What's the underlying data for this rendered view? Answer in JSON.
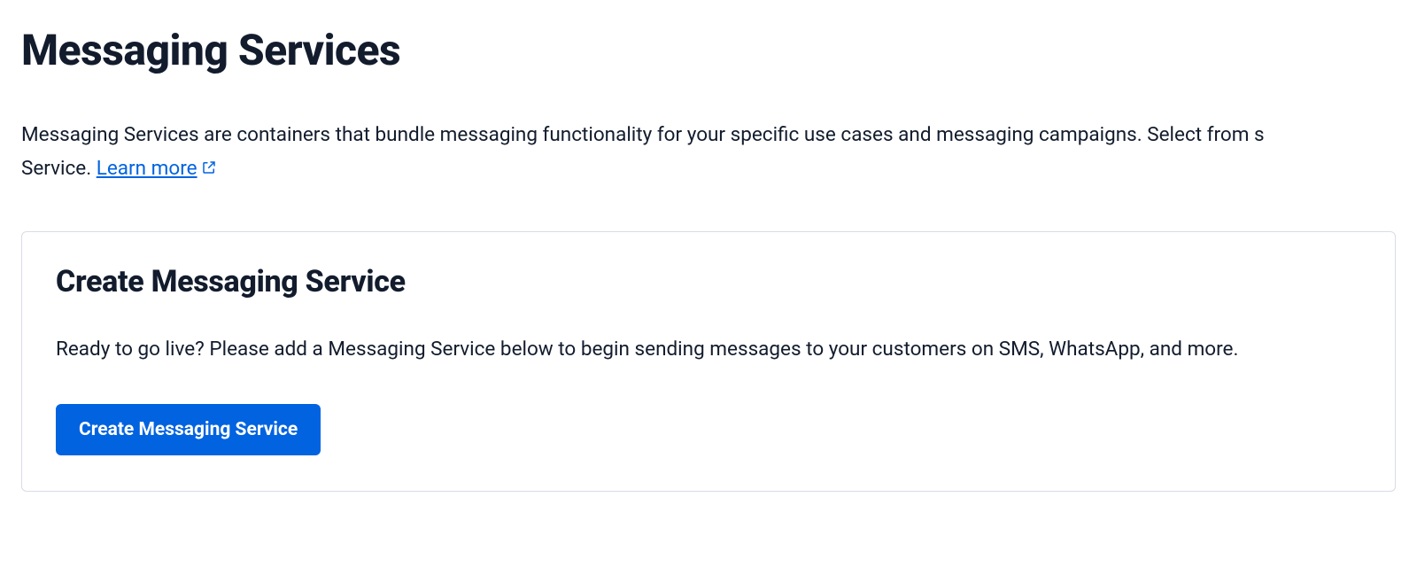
{
  "page": {
    "title": "Messaging Services",
    "description_prefix": "Messaging Services are containers that bundle messaging functionality for your specific use cases and messaging campaigns. Select from s",
    "description_suffix": "Service. ",
    "learn_more_label": "Learn more"
  },
  "card": {
    "title": "Create Messaging Service",
    "description": "Ready to go live? Please add a Messaging Service below to begin sending messages to your customers on SMS, WhatsApp, and more.",
    "button_label": "Create Messaging Service"
  }
}
